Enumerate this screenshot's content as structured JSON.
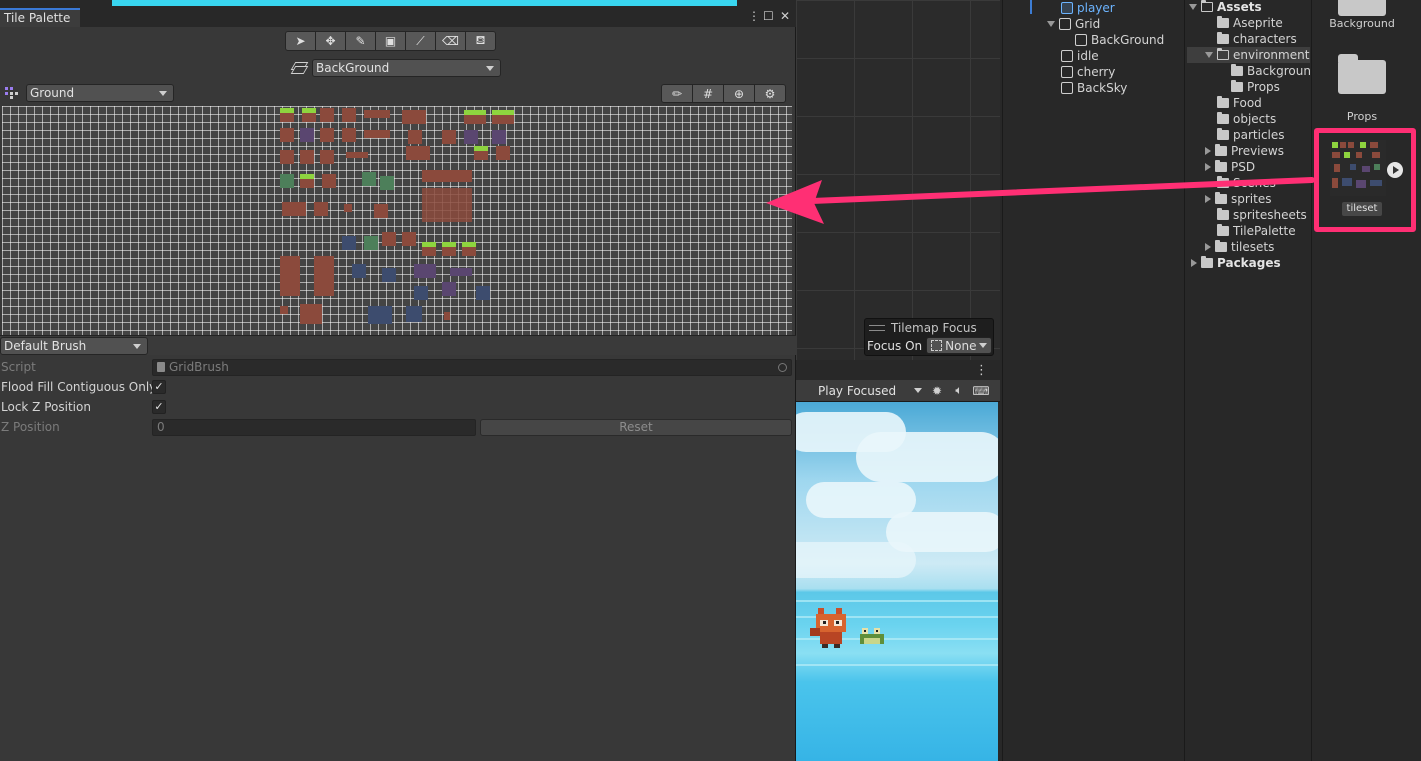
{
  "tile_palette": {
    "tab_title": "Tile Palette",
    "tools": [
      "select",
      "move",
      "paint",
      "box-fill",
      "picker",
      "erase",
      "fill"
    ],
    "active_tilemap": "BackGround",
    "palette": "Ground",
    "brush": "Default Brush",
    "inspector": {
      "script_label": "Script",
      "script_value": "GridBrush",
      "flood_fill_label": "Flood Fill Contiguous Only",
      "flood_fill_checked": "✓",
      "lock_z_label": "Lock Z Position",
      "lock_z_checked": "✓",
      "z_position_label": "Z Position",
      "z_position_value": "0",
      "reset_label": "Reset"
    }
  },
  "tilemap_focus": {
    "title": "Tilemap Focus",
    "focus_on_label": "Focus On",
    "focus_on_value": "None"
  },
  "game_view": {
    "mode": "Play Focused"
  },
  "hierarchy": {
    "items": [
      {
        "label": "player",
        "selected": true
      },
      {
        "label": "Grid"
      },
      {
        "label": "BackGround"
      },
      {
        "label": "idle"
      },
      {
        "label": "cherry"
      },
      {
        "label": "BackSky"
      }
    ]
  },
  "project": {
    "tree": [
      "Assets",
      "Aseprite",
      "characters",
      "environment",
      "Backgroun",
      "Props",
      "Food",
      "objects",
      "particles",
      "Previews",
      "PSD",
      "Scenes",
      "sprites",
      "spritesheets",
      "TilePalette",
      "tilesets",
      "Packages"
    ],
    "grid": [
      {
        "label": "Background"
      },
      {
        "label": "Props"
      },
      {
        "label": "tileset"
      }
    ]
  },
  "colors": {
    "highlight": "#ff2f74",
    "accent": "#3a79d6"
  }
}
